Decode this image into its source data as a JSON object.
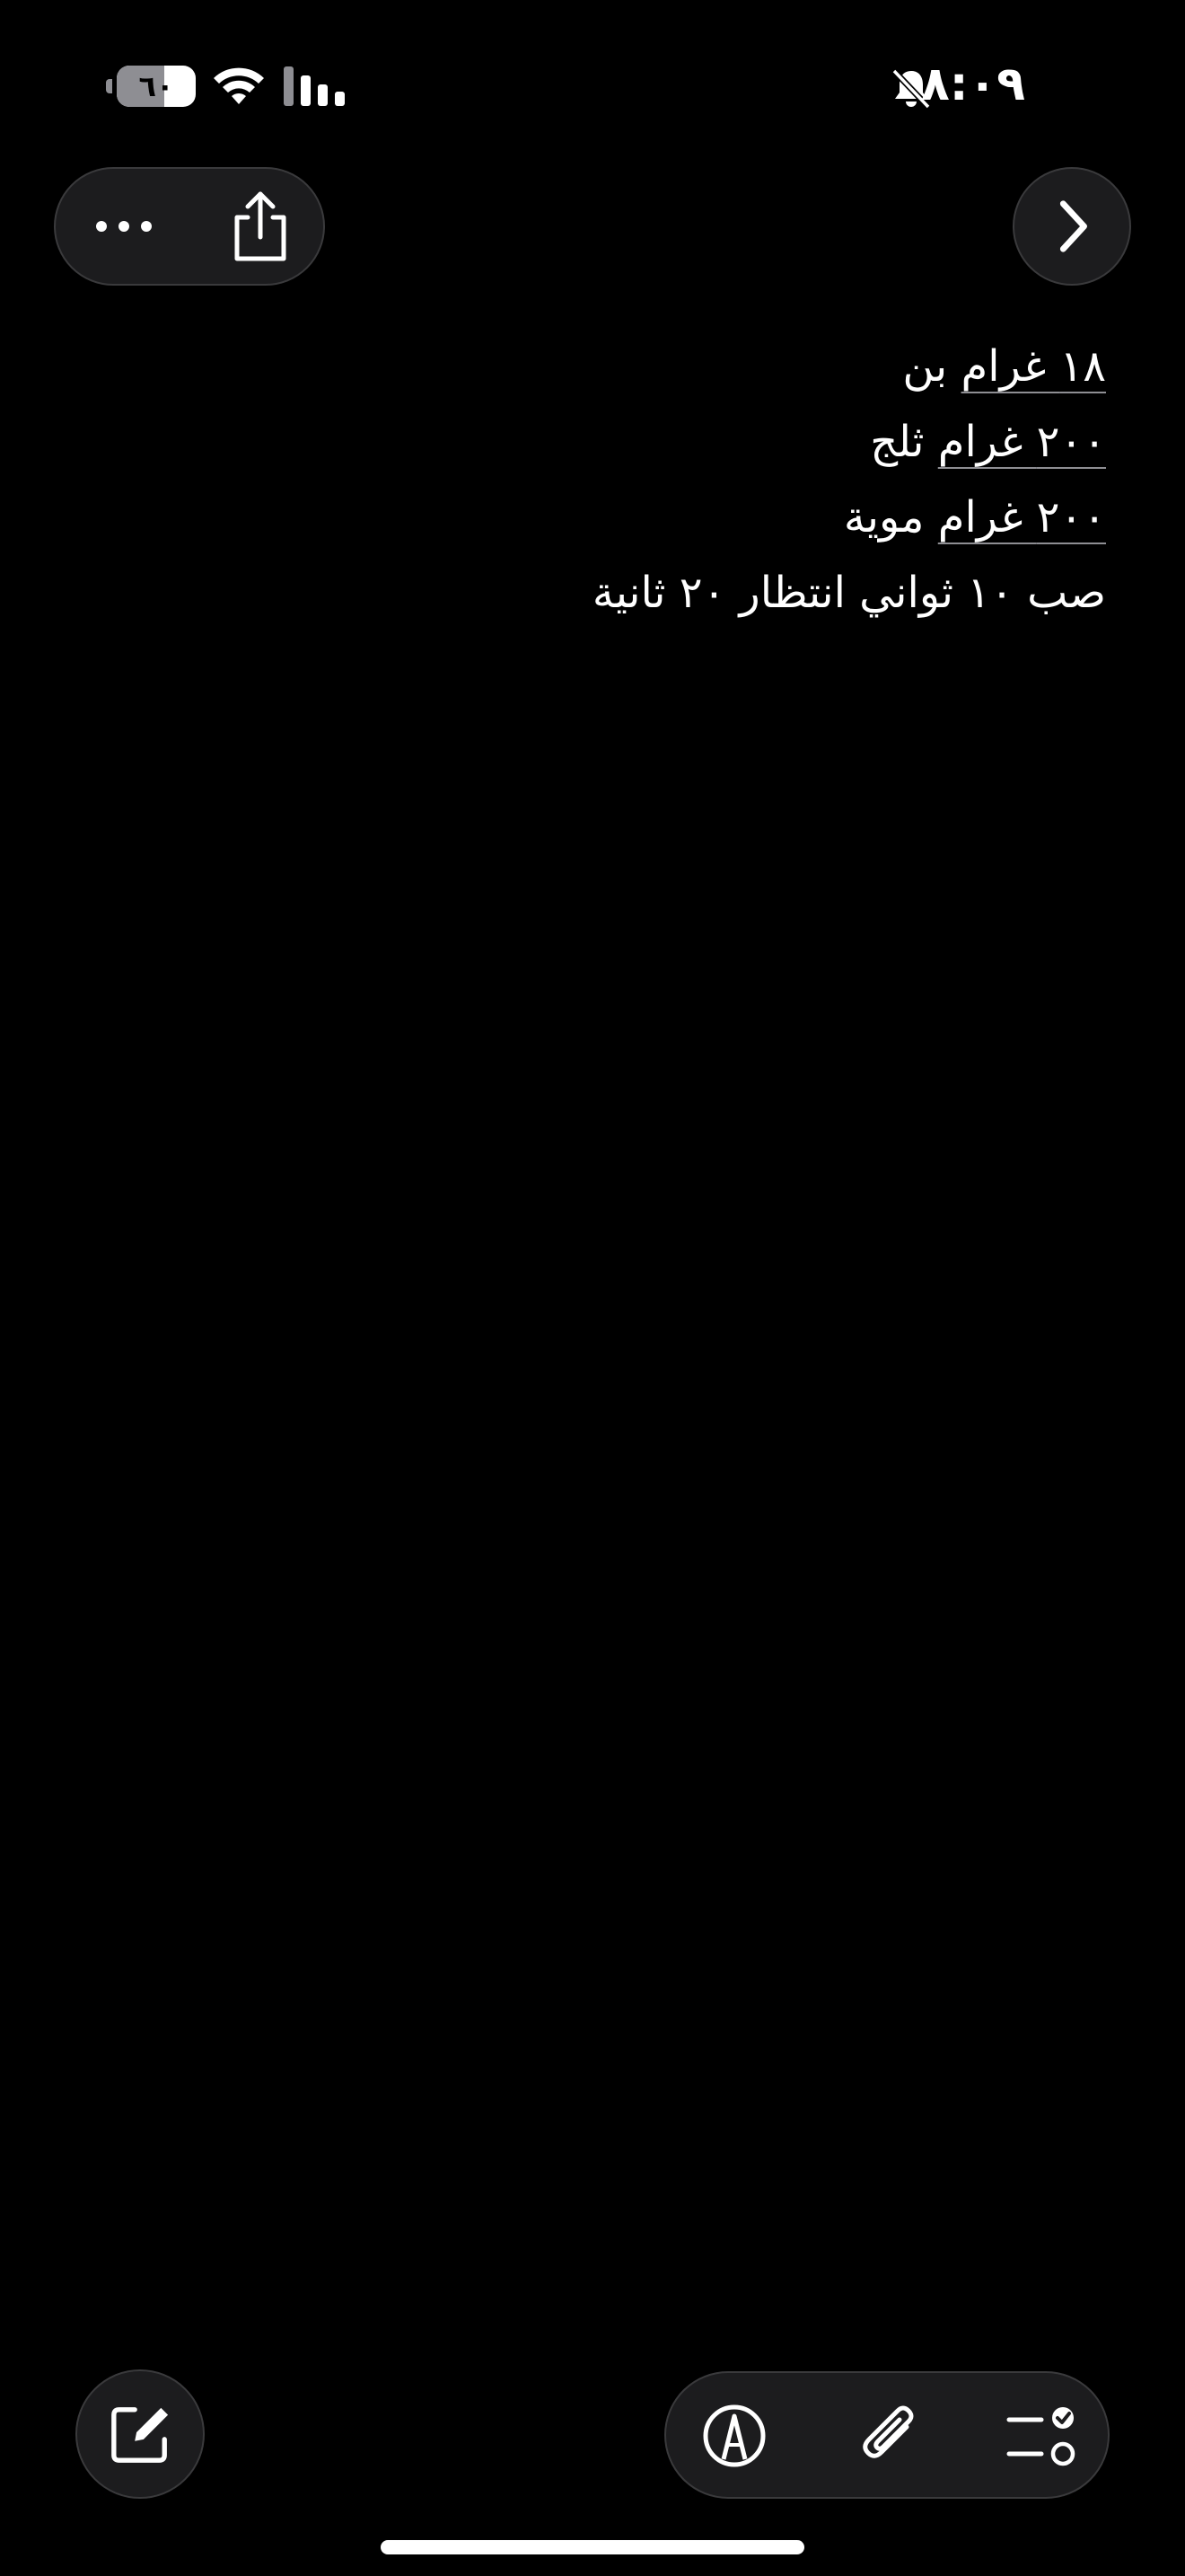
{
  "status_bar": {
    "time": "٨:٠٩",
    "battery_level_label": "٦٠",
    "battery_level": 0.6,
    "icons": [
      "bell-slash-icon",
      "wifi-icon",
      "cellular-signal-icon",
      "battery-icon"
    ]
  },
  "toolbar_top": {
    "icons": [
      "more-ellipsis-icon",
      "share-icon",
      "chevron-right-icon"
    ]
  },
  "note": {
    "lines": [
      {
        "quantity": "١٨ غرام",
        "rest": " بن"
      },
      {
        "quantity": "٢٠٠ غرام",
        "rest": " ثلج"
      },
      {
        "quantity": "٢٠٠ غرام",
        "rest": " موية"
      },
      {
        "quantity": "",
        "rest": "صب ١٠ ثواني انتظار ٢٠ ثانية"
      }
    ]
  },
  "toolbar_bottom": {
    "icons": [
      "compose-icon",
      "markup-pen-icon",
      "paperclip-icon",
      "checklist-icon"
    ]
  },
  "colors": {
    "background": "#000000",
    "pill_background": "#1c1c1e",
    "pill_border": "#3a3a3c",
    "text": "#ffffff",
    "underline": "#8e8e93"
  }
}
